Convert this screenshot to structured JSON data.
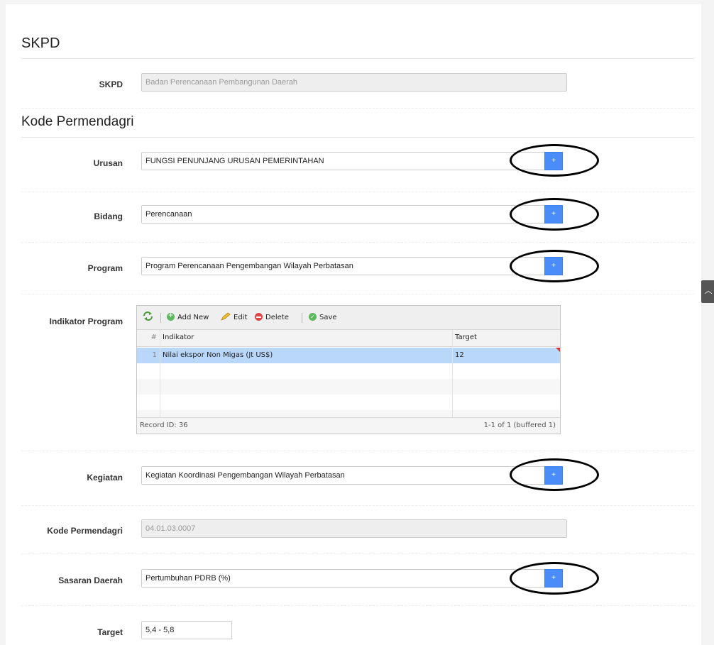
{
  "sections": {
    "skpd_title": "SKPD",
    "kode_title": "Kode Permendagri"
  },
  "fields": {
    "skpd": {
      "label": "SKPD",
      "value": "Badan Perencanaan Pembangunan Daerah"
    },
    "urusan": {
      "label": "Urusan",
      "value": "FUNGSI PENUNJANG URUSAN PEMERINTAHAN"
    },
    "bidang": {
      "label": "Bidang",
      "value": "Perencanaan"
    },
    "program": {
      "label": "Program",
      "value": "Program Perencanaan Pengembangan Wilayah Perbatasan"
    },
    "indikator_program": {
      "label": "Indikator Program"
    },
    "kegiatan": {
      "label": "Kegiatan",
      "value": "Kegiatan  Koordinasi Pengembangan Wilayah Perbatasan"
    },
    "kode_permendagri": {
      "label": "Kode Permendagri",
      "value": "04.01.03.0007"
    },
    "sasaran_daerah": {
      "label": "Sasaran Daerah",
      "value": "Pertumbuhan   PDRB  (%)"
    },
    "target": {
      "label": "Target",
      "value": "5,4 - 5,8"
    }
  },
  "plus_button_label": "+",
  "grid": {
    "toolbar": {
      "add_new": "Add New",
      "edit": "Edit",
      "delete": "Delete",
      "save": "Save"
    },
    "columns": {
      "num": "#",
      "indikator": "Indikator",
      "target": "Target"
    },
    "rows": [
      {
        "num": "1",
        "indikator": "Nilai ekspor Non Migas (Jt US$)",
        "target": "12"
      }
    ],
    "footer": {
      "record": "Record ID: 36",
      "paging": "1-1 of 1 (buffered 1)"
    }
  },
  "scroll_top_icon": "chevron-up-icon",
  "colors": {
    "accent": "#4b8df8",
    "selected_row": "#b9d7f8",
    "annotation_circle": "#000000"
  }
}
